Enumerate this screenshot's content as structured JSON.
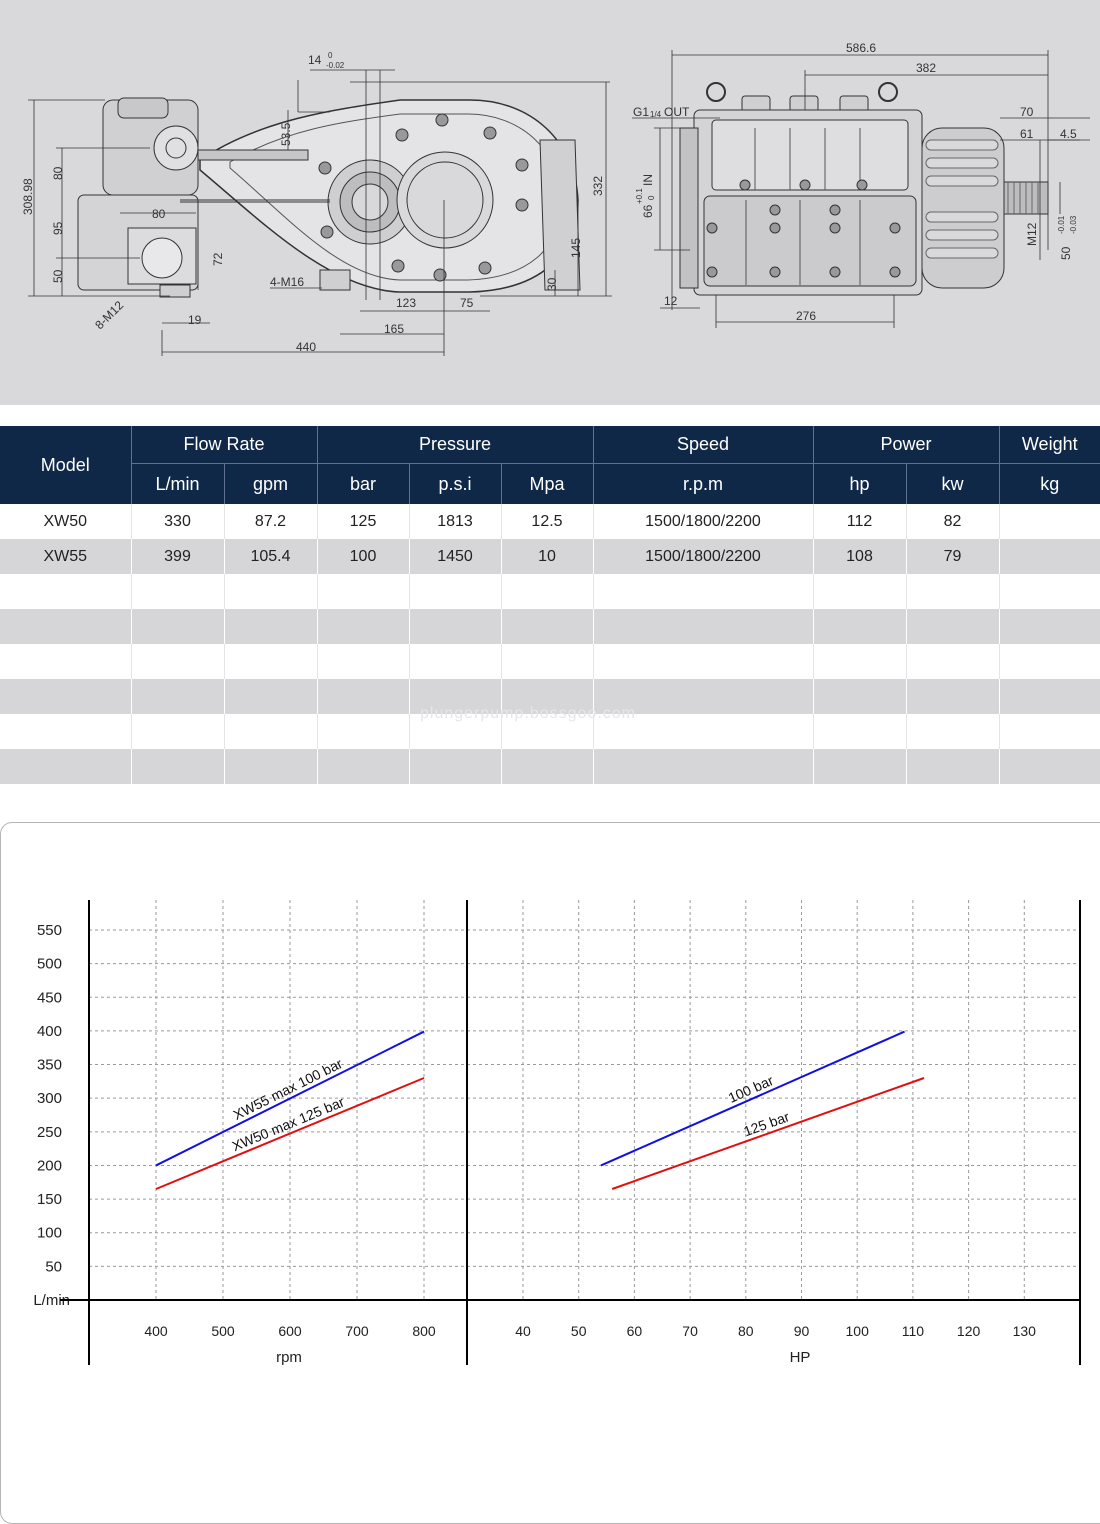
{
  "drawing": {
    "front_dims": [
      "14",
      "0",
      "-0.02",
      "53.5",
      "308.98",
      "80",
      "95",
      "50",
      "80",
      "72",
      "4-M16",
      "8-M12",
      "19",
      "123",
      "75",
      "165",
      "440",
      "30",
      "145",
      "332"
    ],
    "side_dims": [
      "586.6",
      "382",
      "70",
      "61",
      "4.5",
      "G1",
      "1/4",
      "OUT",
      "66",
      "+0.1",
      "0",
      "IN",
      "12",
      "276",
      "M12",
      "50",
      "-0.01",
      "-0.03"
    ]
  },
  "table": {
    "headers": {
      "model": "Model",
      "flow_rate": "Flow Rate",
      "pressure": "Pressure",
      "speed": "Speed",
      "power": "Power",
      "weight": "Weight"
    },
    "units": [
      "L/min",
      "gpm",
      "bar",
      "p.s.i",
      "Mpa",
      "r.p.m",
      "hp",
      "kw",
      "kg"
    ],
    "rows": [
      [
        "XW50",
        "330",
        "87.2",
        "125",
        "1813",
        "12.5",
        "1500/1800/2200",
        "112",
        "82",
        ""
      ],
      [
        "XW55",
        "399",
        "105.4",
        "100",
        "1450",
        "10",
        "1500/1800/2200",
        "108",
        "79",
        ""
      ],
      [
        "",
        "",
        "",
        "",
        "",
        "",
        "",
        "",
        "",
        ""
      ],
      [
        "",
        "",
        "",
        "",
        "",
        "",
        "",
        "",
        "",
        ""
      ],
      [
        "",
        "",
        "",
        "",
        "",
        "",
        "",
        "",
        "",
        ""
      ],
      [
        "",
        "",
        "",
        "",
        "",
        "",
        "",
        "",
        "",
        ""
      ],
      [
        "",
        "",
        "",
        "",
        "",
        "",
        "",
        "",
        "",
        ""
      ],
      [
        "",
        "",
        "",
        "",
        "",
        "",
        "",
        "",
        "",
        ""
      ]
    ]
  },
  "watermark": "plungerpump.bossgoo.com",
  "chart_data": [
    {
      "type": "line",
      "xlabel": "rpm",
      "ylabel": "L/min",
      "xticks": [
        400,
        500,
        600,
        700,
        800
      ],
      "yticks": [
        50,
        100,
        150,
        200,
        250,
        300,
        350,
        400,
        450,
        500,
        550
      ],
      "xlim": [
        300,
        800
      ],
      "ylim": [
        0,
        550
      ],
      "grid": true,
      "series": [
        {
          "name": "XW55 max 100 bar",
          "color": "#1010e0",
          "x": [
            400,
            800
          ],
          "y": [
            200,
            399
          ]
        },
        {
          "name": "XW50 max 125 bar",
          "color": "#e01010",
          "x": [
            400,
            800
          ],
          "y": [
            165,
            330
          ]
        }
      ]
    },
    {
      "type": "line",
      "xlabel": "HP",
      "ylabel": "",
      "xticks": [
        40,
        50,
        60,
        70,
        80,
        90,
        100,
        110,
        120,
        130
      ],
      "yticks": [],
      "xlim": [
        30,
        130
      ],
      "ylim": [
        0,
        550
      ],
      "grid": true,
      "series": [
        {
          "name": "100 bar",
          "color": "#1010e0",
          "x": [
            54,
            108.5
          ],
          "y": [
            200,
            399
          ]
        },
        {
          "name": "125 bar",
          "color": "#e01010",
          "x": [
            56,
            112
          ],
          "y": [
            165,
            330
          ]
        }
      ]
    }
  ]
}
